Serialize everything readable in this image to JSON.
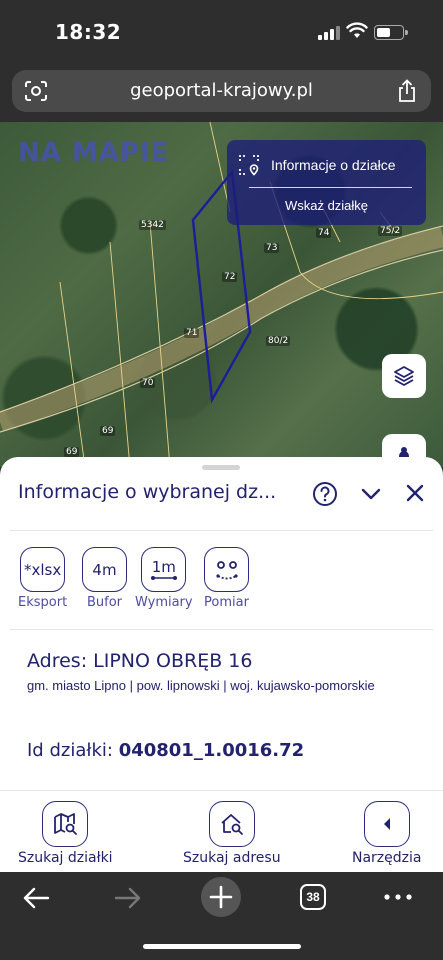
{
  "status_bar": {
    "time": "18:32"
  },
  "browser": {
    "url": "geoportal-krajowy.pl",
    "tab_count": "38"
  },
  "map": {
    "logo": "NA MAPIE",
    "parcel_labels": [
      "5342",
      "73",
      "74",
      "75/2",
      "72",
      "71",
      "80/2",
      "70",
      "69",
      "69"
    ],
    "info_box": {
      "title": "Informacje o działce",
      "action": "Wskaż działkę"
    }
  },
  "sheet": {
    "title": "Informacje o wybranej dz...",
    "tools": [
      {
        "icon": "*xlsx",
        "label": "Eksport"
      },
      {
        "icon": "4m",
        "label": "Bufor"
      },
      {
        "icon": "1m",
        "label": "Wymiary"
      },
      {
        "icon": "",
        "label": "Pomiar"
      }
    ],
    "address": "Adres: LIPNO OBRĘB 16",
    "address_details": "gm. miasto Lipno | pow. lipnowski | woj. kujawsko-pomorskie",
    "parcel_id_label": "Id działki: ",
    "parcel_id_value": "040801_1.0016.72"
  },
  "bottom_nav": [
    {
      "label": "Szukaj działki",
      "icon": "map-search-icon"
    },
    {
      "label": "Szukaj adresu",
      "icon": "home-search-icon"
    },
    {
      "label": "Narzędzia",
      "icon": "chevron-left-icon"
    }
  ],
  "colors": {
    "accent": "#22226e",
    "info_box": "#1e1e78",
    "parcel_outline": "#1d1d9a"
  }
}
